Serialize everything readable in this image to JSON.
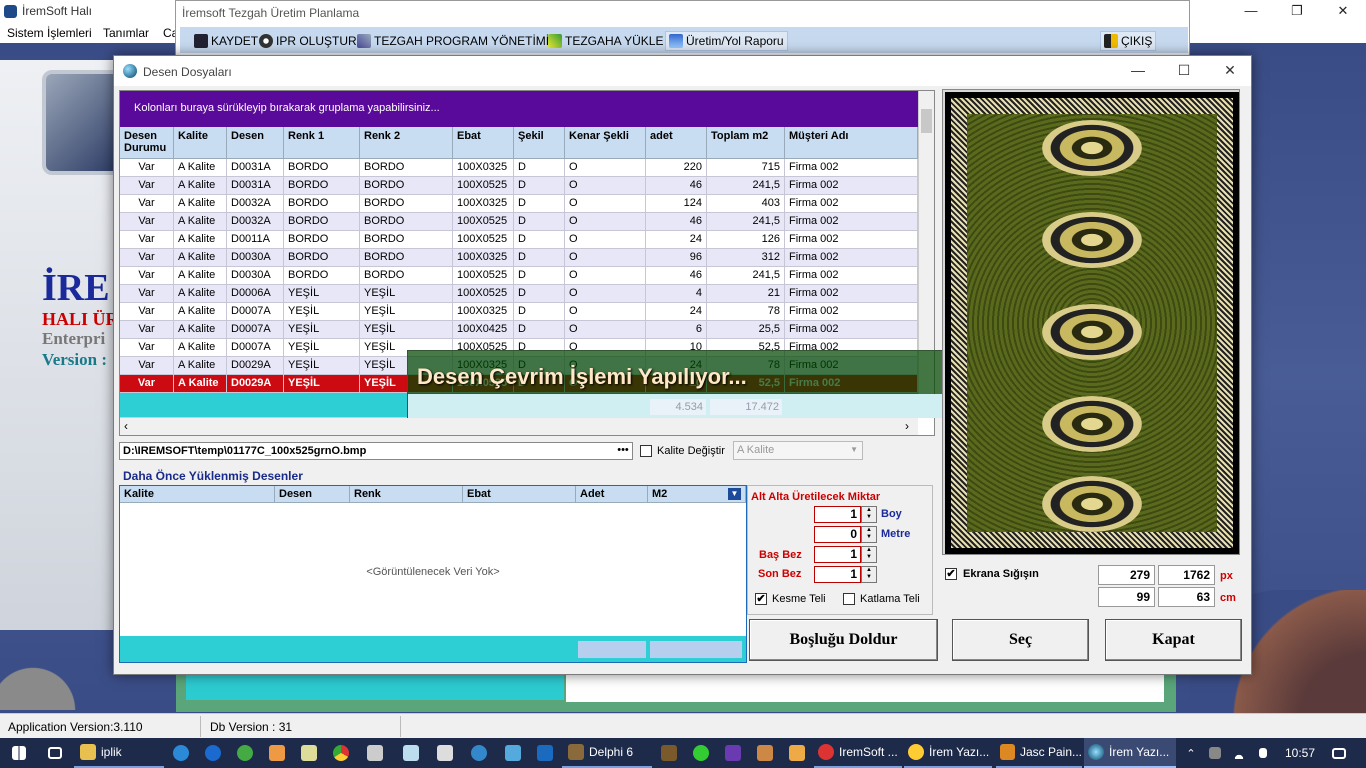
{
  "main_window": {
    "title": "İremSoft Halı",
    "controls": [
      "—",
      "❐",
      "✕"
    ]
  },
  "menu": [
    "Sistem İşlemleri",
    "Tanımlar",
    "Ca"
  ],
  "brand": {
    "line1": "İRE",
    "line2": "HALI ÜR",
    "line3": "Enterpri",
    "line4": "Version :"
  },
  "status": {
    "app_version": "Application Version:3.110",
    "db_version": "Db Version : 31"
  },
  "plan_window": {
    "title": "İremsoft Tezgah Üretim Planlama",
    "toolbar": {
      "save": "KAYDET",
      "ipr": "IPR OLUŞTUR",
      "program": "TEZGAH PROGRAM YÖNETİMİ",
      "load": "TEZGAHA YÜKLE",
      "report": "Üretim/Yol Raporu",
      "exit": "ÇIKIŞ"
    }
  },
  "dialog": {
    "title": "Desen Dosyaları",
    "group_hint": "Kolonları buraya sürükleyip bırakarak gruplama yapabilirsiniz...",
    "columns": [
      "Desen Durumu",
      "Kalite",
      "Desen",
      "Renk 1",
      "Renk 2",
      "Ebat",
      "Şekil",
      "Kenar Şekli",
      "adet",
      "Toplam m2",
      "Müşteri Adı"
    ],
    "rows": [
      [
        "Var",
        "A Kalite",
        "D0031A",
        "BORDO",
        "BORDO",
        "100X0325",
        "D",
        "O",
        "220",
        "715",
        "Firma 002"
      ],
      [
        "Var",
        "A Kalite",
        "D0031A",
        "BORDO",
        "BORDO",
        "100X0525",
        "D",
        "O",
        "46",
        "241,5",
        "Firma 002"
      ],
      [
        "Var",
        "A Kalite",
        "D0032A",
        "BORDO",
        "BORDO",
        "100X0325",
        "D",
        "O",
        "124",
        "403",
        "Firma 002"
      ],
      [
        "Var",
        "A Kalite",
        "D0032A",
        "BORDO",
        "BORDO",
        "100X0525",
        "D",
        "O",
        "46",
        "241,5",
        "Firma 002"
      ],
      [
        "Var",
        "A Kalite",
        "D0011A",
        "BORDO",
        "BORDO",
        "100X0525",
        "D",
        "O",
        "24",
        "126",
        "Firma 002"
      ],
      [
        "Var",
        "A Kalite",
        "D0030A",
        "BORDO",
        "BORDO",
        "100X0325",
        "D",
        "O",
        "96",
        "312",
        "Firma 002"
      ],
      [
        "Var",
        "A Kalite",
        "D0030A",
        "BORDO",
        "BORDO",
        "100X0525",
        "D",
        "O",
        "46",
        "241,5",
        "Firma 002"
      ],
      [
        "Var",
        "A Kalite",
        "D0006A",
        "YEŞİL",
        "YEŞİL",
        "100X0525",
        "D",
        "O",
        "4",
        "21",
        "Firma 002"
      ],
      [
        "Var",
        "A Kalite",
        "D0007A",
        "YEŞİL",
        "YEŞİL",
        "100X0325",
        "D",
        "O",
        "24",
        "78",
        "Firma 002"
      ],
      [
        "Var",
        "A Kalite",
        "D0007A",
        "YEŞİL",
        "YEŞİL",
        "100X0425",
        "D",
        "O",
        "6",
        "25,5",
        "Firma 002"
      ],
      [
        "Var",
        "A Kalite",
        "D0007A",
        "YEŞİL",
        "YEŞİL",
        "100X0525",
        "D",
        "O",
        "10",
        "52,5",
        "Firma 002"
      ],
      [
        "Var",
        "A Kalite",
        "D0029A",
        "YEŞİL",
        "YEŞİL",
        "100X0325",
        "D",
        "O",
        "24",
        "78",
        "Firma 002"
      ],
      [
        "Var",
        "A Kalite",
        "D0029A",
        "YEŞİL",
        "YEŞİL",
        "100X0525",
        "D",
        "O",
        "10",
        "52,5",
        "Firma 002"
      ]
    ],
    "totals": {
      "adet": "4.534",
      "m2": "17.472"
    },
    "overlay_message": "Desen Çevrim İşlemi Yapılıyor...",
    "file_path": "D:\\IREMSOFT\\temp\\01177C_100x525grnO.bmp",
    "browse_label": "•••",
    "kalite_degistir_label": "Kalite Değiştir",
    "kalite_select": "A Kalite",
    "previous_title": "Daha Önce Yüklenmiş Desenler",
    "prev_columns": [
      "Kalite",
      "Desen",
      "Renk",
      "Ebat",
      "Adet",
      "M2"
    ],
    "prev_empty": "<Görüntülenecek Veri Yok>",
    "alt_alta": {
      "title": "Alt Alta Üretilecek Miktar",
      "boy_value": "1",
      "boy_label": "Boy",
      "metre_value": "0",
      "metre_label": "Metre",
      "bas_label": "Baş Bez",
      "bas_value": "1",
      "son_label": "Son Bez",
      "son_value": "1"
    },
    "kesme_label": "Kesme Teli",
    "kesme_checked": "✔",
    "katlama_label": "Katlama Teli",
    "ekrana_label": "Ekrana Sığışın",
    "ekrana_checked": "✔",
    "px": {
      "w": "279",
      "h": "1762",
      "unit": "px"
    },
    "cm": {
      "w": "99",
      "h": "63",
      "unit": "cm"
    },
    "buttons": {
      "fill": "Boşluğu Doldur",
      "select": "Seç",
      "close": "Kapat"
    },
    "controls": [
      "—",
      "☐",
      "✕"
    ]
  },
  "taskbar": {
    "search_app": "iplik",
    "items": [
      "Delphi 6",
      "IremSoft ...",
      "İrem Yazı...",
      "Jasc Pain...",
      "İrem Yazı..."
    ],
    "time": "10:57"
  }
}
